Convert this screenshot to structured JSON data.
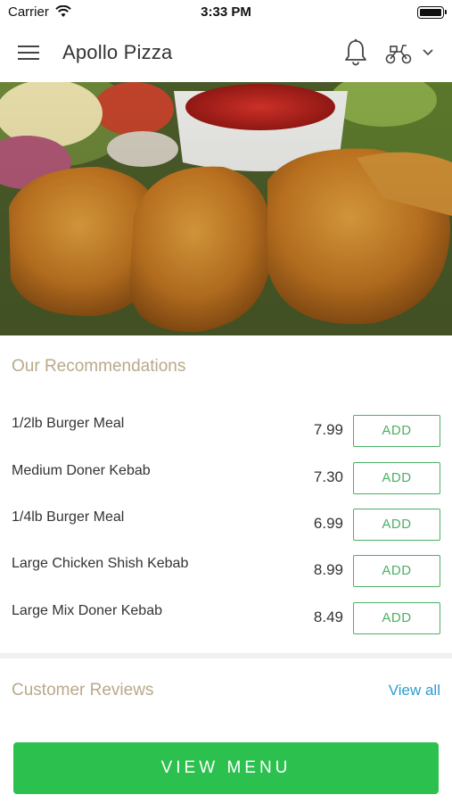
{
  "status_bar": {
    "carrier": "Carrier",
    "time": "3:33 PM"
  },
  "header": {
    "title": "Apollo Pizza",
    "icons": [
      "menu-icon",
      "bell-icon",
      "scooter-icon",
      "chevron-down-icon"
    ]
  },
  "hero": {
    "image": "fried-chicken-nuggets-with-ketchup-and-salad"
  },
  "recommendations": {
    "title": "Our Recommendations",
    "add_label": "ADD",
    "items": [
      {
        "name": "1/2lb Burger Meal",
        "price": "7.99"
      },
      {
        "name": "Medium Doner Kebab",
        "price": "7.30"
      },
      {
        "name": "1/4lb Burger Meal",
        "price": "6.99"
      },
      {
        "name": "Large Chicken Shish Kebab",
        "price": "8.99"
      },
      {
        "name": "Large Mix Doner Kebab",
        "price": "8.49"
      }
    ]
  },
  "reviews": {
    "title": "Customer Reviews",
    "view_all": "View all"
  },
  "footer": {
    "view_menu": "VIEW MENU"
  },
  "colors": {
    "accent_green": "#2cc04e",
    "add_border": "#4caf65",
    "section_title": "#b8a98a",
    "link_blue": "#2a9fd0"
  }
}
